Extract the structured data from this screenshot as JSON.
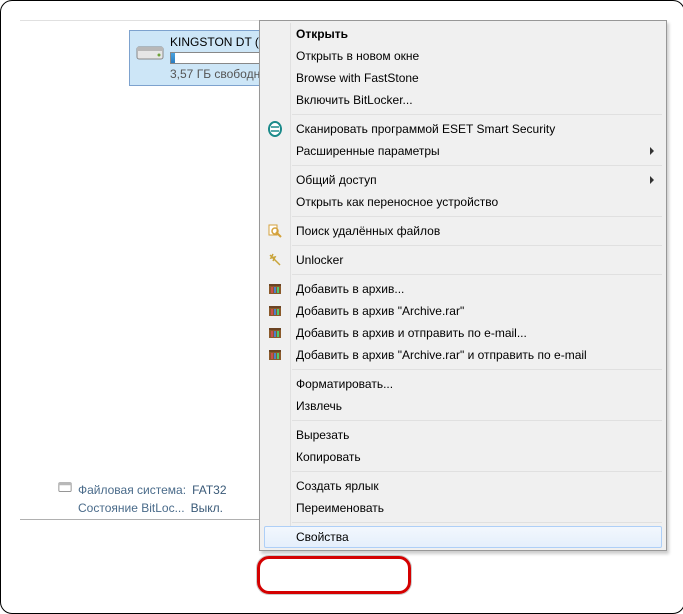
{
  "drive": {
    "label": "KINGSTON DT (",
    "free_space": "3,57 ГБ свободн",
    "fill_pct": 4
  },
  "status": {
    "fs_label": "Файловая система:",
    "fs_value": "FAT32",
    "bitlocker_label": "Состояние BitLoc...",
    "bitlocker_value": "Выкл."
  },
  "menu": {
    "open": "Открыть",
    "open_new": "Открыть в новом окне",
    "browse_faststone": "Browse with FastStone",
    "bitlocker": "Включить BitLocker...",
    "eset_scan": "Сканировать программой ESET Smart Security",
    "eset_adv": "Расширенные параметры",
    "share": "Общий доступ",
    "portable": "Открыть как переносное устройство",
    "find_deleted": "Поиск удалённых файлов",
    "unlocker": "Unlocker",
    "rar_add": "Добавить в архив...",
    "rar_add_name": "Добавить в архив \"Archive.rar\"",
    "rar_email": "Добавить в архив и отправить по e-mail...",
    "rar_name_email": "Добавить в архив \"Archive.rar\" и отправить по e-mail",
    "format": "Форматировать...",
    "eject": "Извлечь",
    "cut": "Вырезать",
    "copy": "Копировать",
    "shortcut": "Создать ярлык",
    "rename": "Переименовать",
    "properties": "Свойства"
  }
}
